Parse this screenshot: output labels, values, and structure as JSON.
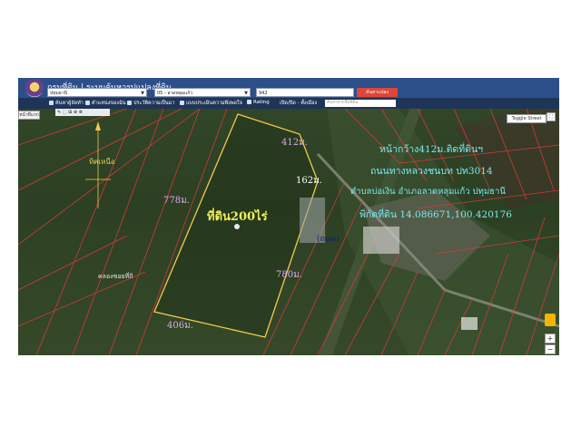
{
  "header": {
    "title": "กรมที่ดิน | ระบบค้นหารูปแปลงที่ดิน"
  },
  "search": {
    "province": "ปทุมธานี",
    "district": "05 - ลาดหลุมแก้ว",
    "parcel": "942",
    "button": "ค้นหาแปลง"
  },
  "toolbar": {
    "items": [
      "ค้นหาผู้จัดทำ",
      "ตำแหน่งของฉัน",
      "ประวัติความเป็นมา",
      "แบบประเมินความพึงพอใจ",
      "Rating",
      "เปิด/ปิด - ตั้งเมือง"
    ],
    "search_placeholder": "ค้นหาจากชื่อที่ดิน"
  },
  "map": {
    "home_button": "หน้าที่แรก",
    "tools": "✎ ⬚ ⊞ ⊕ ⊗",
    "street_view": "Toggle Street View",
    "zoom_in": "+",
    "zoom_out": "−",
    "fullscreen": "⛶",
    "labels": {
      "north": "ทิศเหนือ",
      "edge_top": "412ม.",
      "edge_left": "778ม.",
      "edge_right_top": "162ม.",
      "edge_right": "780ม.",
      "edge_bottom": "406ม.",
      "area": "ที่ดิน200ไร่",
      "road_label": "(ถนน)",
      "canal": "คลองซอยที่8",
      "info_line1": "หน้ากว้าง412ม.ติดที่ดินฯ",
      "info_line2": "ถนนทางหลวงชนบท ปท3014",
      "info_line3": "ตำบลบ่อเงิน อำเภอลาดหลุมแก้ว ปทุมธานี",
      "info_line4": "พิกัดที่ดิน 14.086671,100.420176"
    }
  },
  "colors": {
    "header_bg": "#2c4f8a",
    "toolbar_bg": "#1f3558",
    "button_red": "#e0453a",
    "parcel_lines": "#e03a3a",
    "plot_outline": "#f2c94c"
  }
}
